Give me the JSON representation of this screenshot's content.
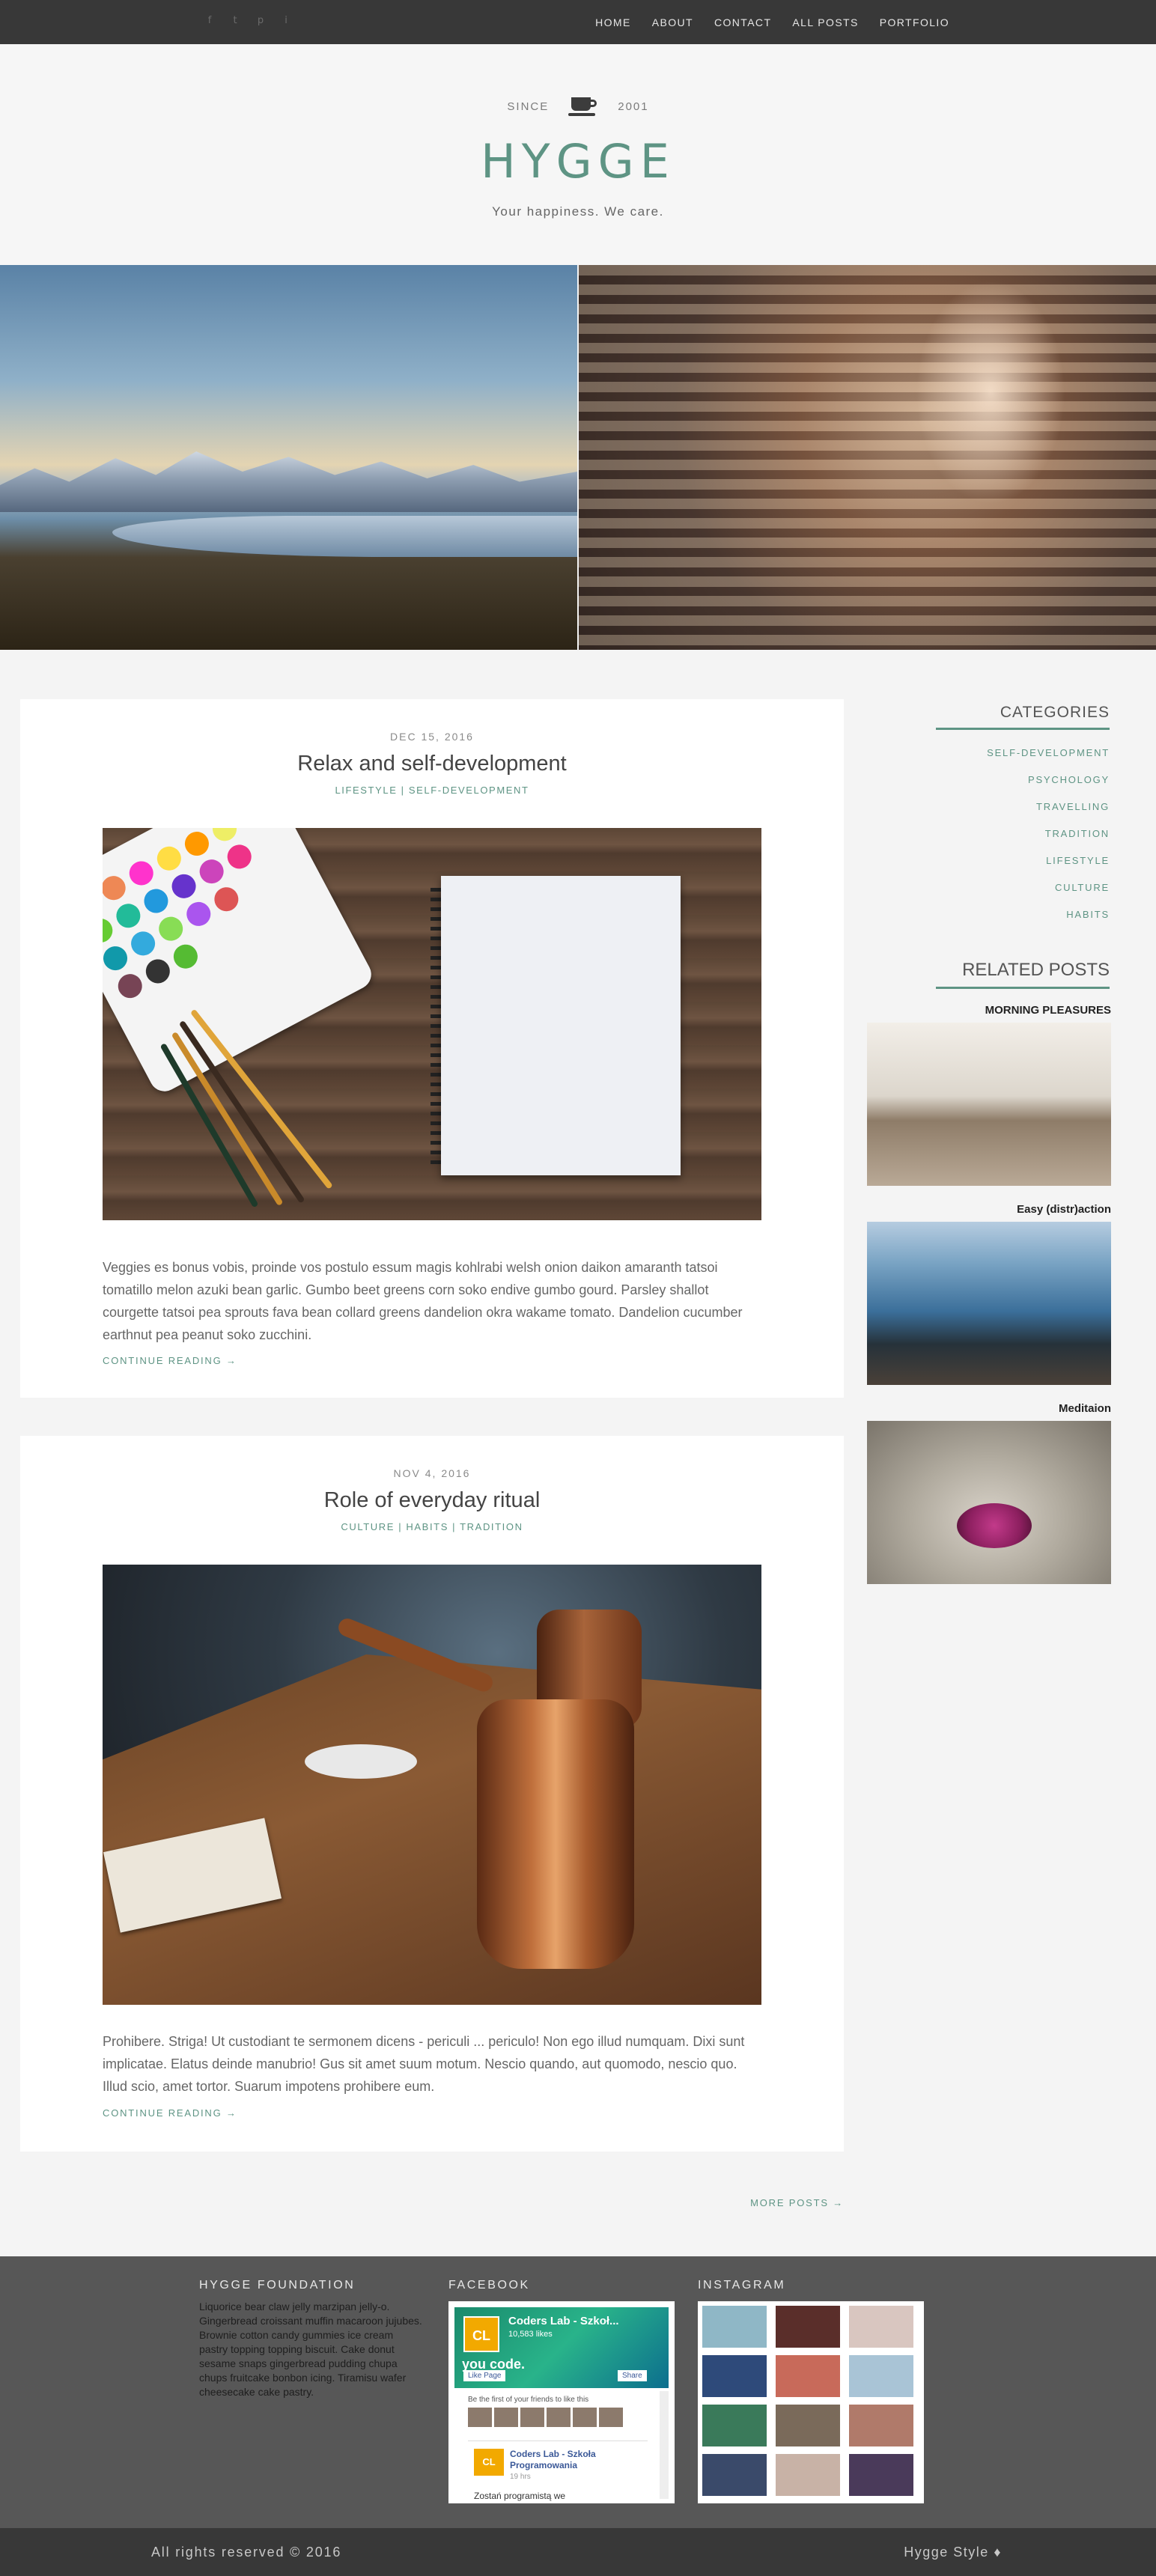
{
  "social": {
    "facebook_icon": "f",
    "twitter_icon": "t",
    "pinterest_icon": "p",
    "instagram_icon": "i"
  },
  "nav": {
    "items": [
      {
        "label": "HOME"
      },
      {
        "label": "ABOUT"
      },
      {
        "label": "CONTACT"
      },
      {
        "label": "ALL POSTS"
      },
      {
        "label": "PORTFOLIO"
      }
    ]
  },
  "header": {
    "since_label": "SINCE",
    "year": "2001",
    "brand": "HYGGE",
    "tagline": "Your happiness. We care."
  },
  "posts": [
    {
      "date": "DEC 15, 2016",
      "title": "Relax and self-development",
      "categories": "LIFESTYLE | SELF-DEVELOPMENT",
      "excerpt": "  Veggies es bonus vobis, proinde vos postulo essum magis kohlrabi welsh onion daikon amaranth tatsoi tomatillo melon azuki bean garlic. Gumbo beet greens corn soko endive gumbo gourd. Parsley shallot courgette tatsoi pea sprouts fava bean collard greens dandelion okra wakame tomato. Dandelion cucumber earthnut pea peanut soko zucchini.",
      "more": "CONTINUE READING →"
    },
    {
      "date": "NOV 4, 2016",
      "title": "Role of everyday ritual",
      "categories": "CULTURE | HABITS | TRADITION",
      "excerpt": "Prohibere. Striga! Ut custodiant te sermonem dicens - periculi ... periculo! Non ego illud numquam. Dixi sunt implicatae. Elatus deinde manubrio! Gus sit amet suum motum. Nescio quando, aut quomodo, nescio quo. Illud scio, amet tortor. Suarum impotens prohibere eum.",
      "more": "CONTINUE READING →"
    }
  ],
  "sidebar": {
    "categories_title": "CATEGORIES",
    "categories": [
      {
        "label": "SELF-DEVELOPMENT"
      },
      {
        "label": "PSYCHOLOGY"
      },
      {
        "label": "TRAVELLING"
      },
      {
        "label": "TRADITION"
      },
      {
        "label": "LIFESTYLE"
      },
      {
        "label": "CULTURE"
      },
      {
        "label": "HABITS"
      }
    ],
    "related_title": "RELATED POSTS",
    "related": [
      {
        "title": "MORNING PLEASURES"
      },
      {
        "title": "Easy (distr)action"
      },
      {
        "title": "Meditaion"
      }
    ]
  },
  "more_posts": "MORE POSTS →",
  "footer": {
    "foundation_title": "HYGGE FOUNDATION",
    "foundation_text": "Liquorice bear claw jelly marzipan jelly-o. Gingerbread croissant muffin macaroon jujubes. Brownie cotton candy gummies ice cream pastry topping topping biscuit. Cake donut sesame snaps gingerbread pudding chupa chups fruitcake bonbon icing. Tiramisu wafer cheesecake cake pastry.",
    "facebook_title": "FACEBOOK",
    "fb": {
      "logo": "CL",
      "page_name": "Coders Lab - Szkoł...",
      "likes": "10,583 likes",
      "slogan": "you code.",
      "like_button": "Like Page",
      "share_button": "Share",
      "friends_text": "Be the first of your friends to like this",
      "post_name": "Coders Lab - Szkoła Programowania",
      "post_time": "19 hrs",
      "post_text": "Zostań programistą we"
    },
    "instagram_title": "INSTAGRAM",
    "instagram_colors": [
      "#8fb7c6",
      "#5a2e2a",
      "#d9c6c0",
      "#2e4a7a",
      "#c86a5a",
      "#a9c4d6",
      "#3a7a5a",
      "#7a6a5a",
      "#b07a6a",
      "#3a4a6a",
      "#c8b2a6",
      "#4a3a5a"
    ]
  },
  "bottom": {
    "copyright": "All rights reserved © 2016",
    "style": "Hygge Style ♦"
  }
}
